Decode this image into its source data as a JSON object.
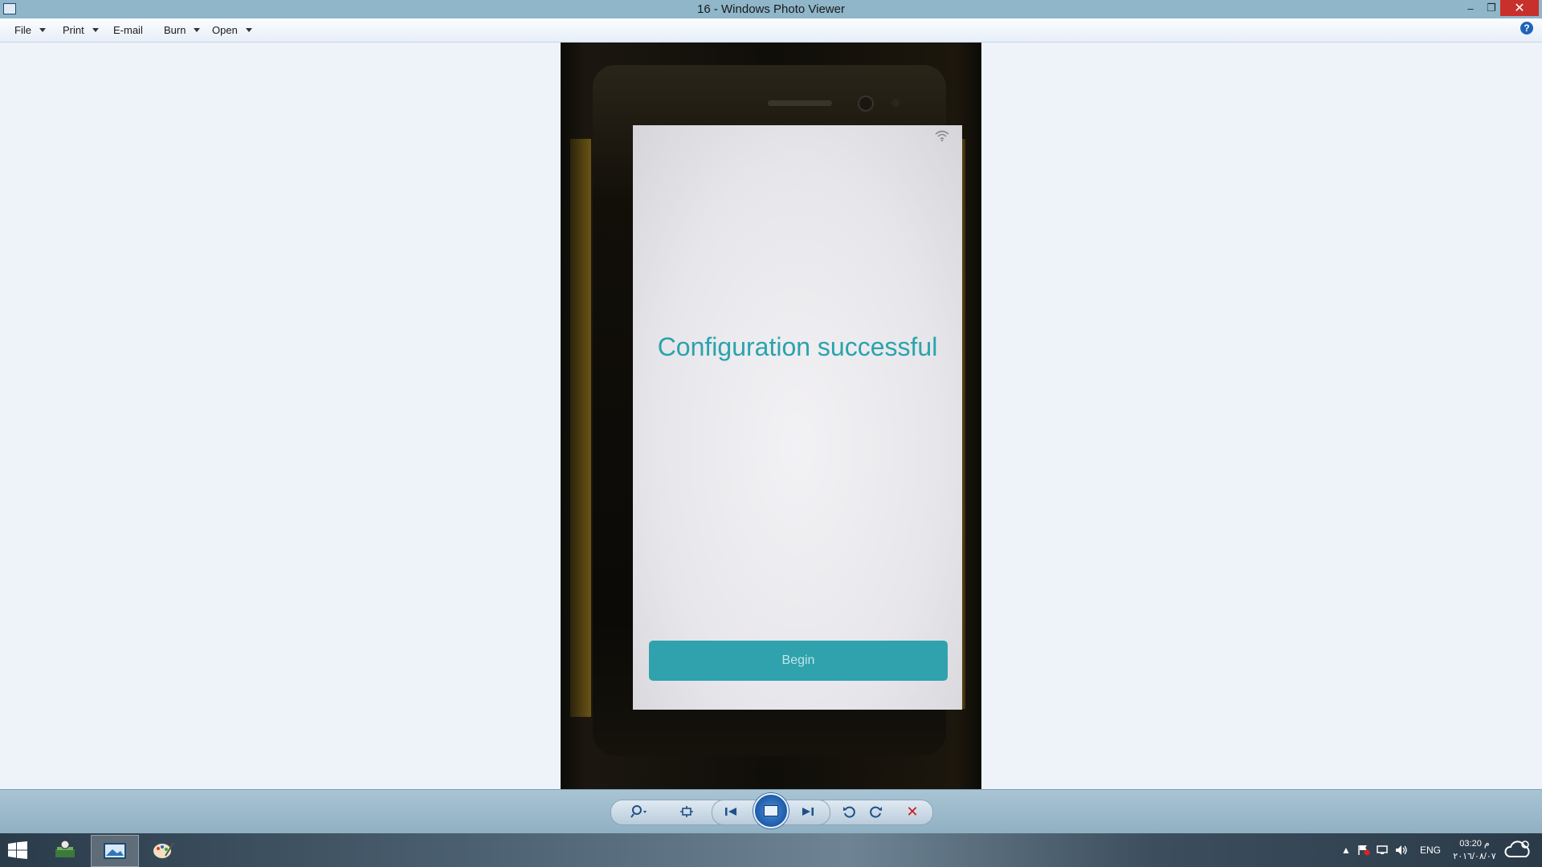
{
  "window": {
    "title": "16 - Windows Photo Viewer"
  },
  "menu": {
    "items": [
      {
        "label": "File",
        "has_dropdown": true
      },
      {
        "label": "Print",
        "has_dropdown": true
      },
      {
        "label": "E-mail",
        "has_dropdown": false
      },
      {
        "label": "Burn",
        "has_dropdown": true
      },
      {
        "label": "Open",
        "has_dropdown": true
      }
    ],
    "help_label": "?"
  },
  "photo": {
    "screen_text": "Configuration successful",
    "button_label": "Begin"
  },
  "toolbar": {
    "icons": [
      "zoom-icon",
      "actual-size-icon",
      "previous-icon",
      "slideshow-icon",
      "next-icon",
      "rotate-counterclockwise-icon",
      "rotate-clockwise-icon",
      "delete-icon"
    ]
  },
  "taskbar": {
    "apps": [
      "start-icon",
      "scanner-app-icon",
      "photo-viewer-app-icon",
      "paint-app-icon"
    ],
    "language": "ENG",
    "time": "03:20 م",
    "date": "٢٠١٦/٠٨/٠٧"
  }
}
